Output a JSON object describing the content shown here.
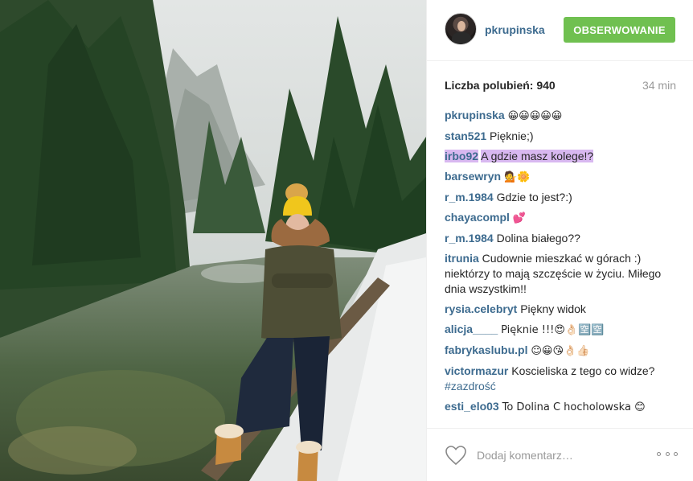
{
  "post": {
    "username": "pkrupinska",
    "follow_label": "OBSERWOWANIE",
    "likes_text": "Liczba polubień: 940",
    "time_ago": "34 min",
    "comment_placeholder": "Dodaj komentarz…"
  },
  "comments": [
    {
      "user": "pkrupinska",
      "text": "😀😀😀😀😀"
    },
    {
      "user": "stan521",
      "text": "Pięknie;)"
    },
    {
      "user": "irbo92",
      "text": "A gdzie masz kolege!?",
      "highlighted": true
    },
    {
      "user": "barsewryn",
      "text": "💁🌼"
    },
    {
      "user": "r_m.1984",
      "text": "Gdzie to jest?:)"
    },
    {
      "user": "chayacompl",
      "text": "💕"
    },
    {
      "user": "r_m.1984",
      "text": "Dolina białego??"
    },
    {
      "user": "itrunia",
      "text": "Cudownie mieszkać w górach :) niektórzy to mają szczęście w życiu. Miłego dnia wszystkim!!"
    },
    {
      "user": "rysia.celebryt",
      "text": "Piękny widok"
    },
    {
      "user": "alicja____",
      "text": "Pięknie !!!😍👌🏻🈳🈳"
    },
    {
      "user": "fabrykaslubu.pl",
      "text": "☺😀😘👌🏻👍🏻"
    },
    {
      "user": "victormazur",
      "text": "Koscieliska z tego co widze?",
      "tag": "#zazdrość"
    },
    {
      "user": "esti_elo03",
      "text": "To Dolina C hocholowska 😊"
    }
  ],
  "colors": {
    "follow_green": "#70c050",
    "username_blue": "#3d6b8f",
    "highlight": "#d8b8f0"
  },
  "icons": {
    "heart": "heart-icon",
    "more": "more-options-icon"
  }
}
